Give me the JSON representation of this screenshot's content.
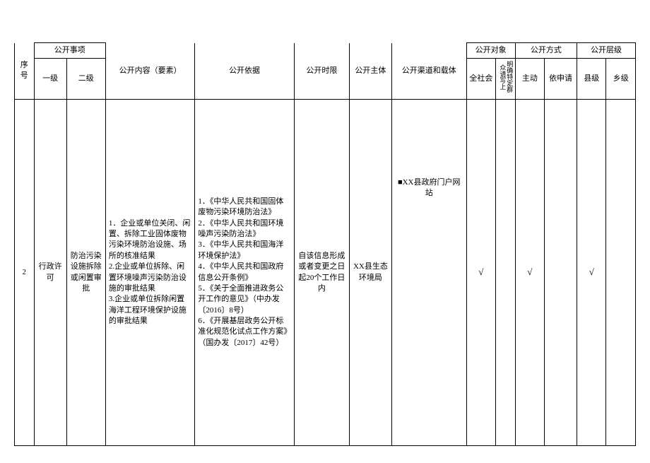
{
  "headers": {
    "serial": "序号",
    "matter_group": "公开事项",
    "level1": "一级",
    "level2": "二级",
    "content": "公开内容（要素）",
    "basis": "公开依据",
    "timelimit": "公开时限",
    "subject": "公开主体",
    "channel": "公开渠道和载体",
    "object_group": "公开对象",
    "object_all": "全社会",
    "object_specific": "明确特定群众请写上",
    "method_group": "公开方式",
    "method_active": "主动",
    "method_onrequest": "依申请",
    "level_group": "公开层级",
    "level_county": "县级",
    "level_township": "乡级"
  },
  "row": {
    "serial": "2",
    "level1": "行政许可",
    "level2": "防治污染设施拆除或闲置审批",
    "content": "1．企业或单位关闭、闲置、拆除工业固体废物污染环境防治设施、场所的核准结果\n2.企业或单位拆除、闲置环境噪声污染防治设施的审批结果\n3.企业或单位拆除闲置海洋工程环境保护设施的审批结果",
    "basis": "1．《中华人民共和国固体废物污染环境防治法》\n2．《中华人民共和国环境噪声污染防治法》\n3．《中华人民共和国海洋环境保护法》\n4．《中华人民共和国政府信息公开条例》\n5．《关于全面推进政务公开工作的意见》（中办发〔2016〕8号）\n6．《开展基层政务公开标准化规范化试点工作方案》（国办发〔2017〕42号）",
    "timelimit": "自该信息形成或者变更之日起20个工作日内",
    "subject": "XX县生态环境局",
    "channel": "■XX县政府门户网站",
    "check_object_all": "√",
    "check_object_specific": "",
    "check_method_active": "√",
    "check_method_onrequest": "",
    "check_level_county": "√",
    "check_level_township": ""
  }
}
